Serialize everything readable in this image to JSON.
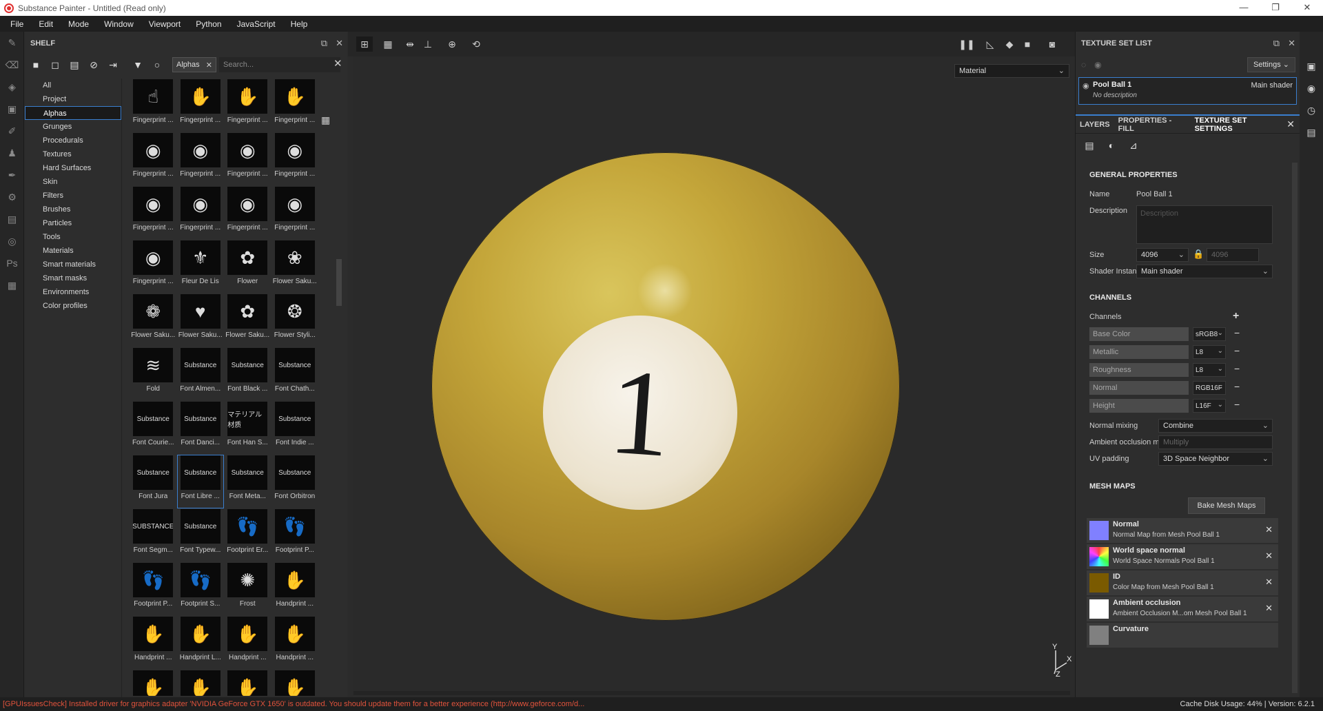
{
  "window": {
    "title": "Substance Painter - Untitled (Read only)",
    "controls": [
      "—",
      "❐",
      "✕"
    ]
  },
  "menu": [
    "File",
    "Edit",
    "Mode",
    "Window",
    "Viewport",
    "Python",
    "JavaScript",
    "Help"
  ],
  "shelf": {
    "title": "SHELF",
    "active_tag": "Alphas",
    "search_placeholder": "Search...",
    "categories": [
      "All",
      "Project",
      "Alphas",
      "Grunges",
      "Procedurals",
      "Textures",
      "Hard Surfaces",
      "Skin",
      "Filters",
      "Brushes",
      "Particles",
      "Tools",
      "Materials",
      "Smart materials",
      "Smart masks",
      "Environments",
      "Color profiles"
    ],
    "selected_category": "Alphas",
    "items": [
      [
        "Fingerprint ...",
        "Fingerprint ...",
        "Fingerprint ...",
        "Fingerprint ..."
      ],
      [
        "Fingerprint ...",
        "Fingerprint ...",
        "Fingerprint ...",
        "Fingerprint ..."
      ],
      [
        "Fingerprint ...",
        "Fingerprint ...",
        "Fingerprint ...",
        "Fingerprint ..."
      ],
      [
        "Fingerprint ...",
        "Fleur De Lis",
        "Flower",
        "Flower Saku..."
      ],
      [
        "Flower Saku...",
        "Flower Saku...",
        "Flower Saku...",
        "Flower Styli..."
      ],
      [
        "Fold",
        "Font Almen...",
        "Font Black ...",
        "Font Chath..."
      ],
      [
        "Font Courie...",
        "Font Danci...",
        "Font Han S...",
        "Font Indie ..."
      ],
      [
        "Font Jura",
        "Font Libre ...",
        "Font Meta...",
        "Font Orbitron"
      ],
      [
        "Font Segm...",
        "Font Typew...",
        "Footprint Er...",
        "Footprint P..."
      ],
      [
        "Footprint P...",
        "Footprint S...",
        "Frost",
        "Handprint ..."
      ],
      [
        "Handprint ...",
        "Handprint L...",
        "Handprint ...",
        "Handprint ..."
      ],
      [
        "",
        "",
        "",
        ""
      ]
    ],
    "thumb_glyphs": [
      [
        "☝",
        "✋",
        "✋",
        "✋"
      ],
      [
        "◉",
        "◉",
        "◉",
        "◉"
      ],
      [
        "◉",
        "◉",
        "◉",
        "◉"
      ],
      [
        "◉",
        "⚜",
        "✿",
        "❀"
      ],
      [
        "❁",
        "♥",
        "✿",
        "❂"
      ],
      [
        "≋",
        "Substance",
        "Substance",
        "Substance"
      ],
      [
        "Substance",
        "Substance",
        "マテリアル 材质",
        "Substance"
      ],
      [
        "Substance",
        "Substance",
        "Substance",
        "Substance"
      ],
      [
        "SUBSTANCE",
        "Substance",
        "👣",
        "👣"
      ],
      [
        "👣",
        "👣",
        "✺",
        "✋"
      ],
      [
        "✋",
        "✋",
        "✋",
        "✋"
      ],
      [
        "✋",
        "✋",
        "✋",
        "✋"
      ]
    ]
  },
  "viewport": {
    "channel_select": "Material",
    "ball_number": "1",
    "axis_y": "Y",
    "axis_x": "X",
    "axis_z": "Z"
  },
  "texture_set_list": {
    "title": "TEXTURE SET LIST",
    "settings_label": "Settings",
    "item_name": "Pool Ball 1",
    "item_shader": "Main shader",
    "item_description": "No description"
  },
  "tabs": [
    "LAYERS",
    "PROPERTIES - FILL",
    "TEXTURE SET SETTINGS"
  ],
  "active_tab": "TEXTURE SET SETTINGS",
  "general": {
    "title": "GENERAL PROPERTIES",
    "name_label": "Name",
    "name_value": "Pool Ball 1",
    "description_label": "Description",
    "description_placeholder": "Description",
    "size_label": "Size",
    "size_value": "4096",
    "size_linked_value": "4096",
    "shader_label": "Shader Instance",
    "shader_value": "Main shader"
  },
  "channels": {
    "title": "CHANNELS",
    "label": "Channels",
    "list": [
      {
        "name": "Base Color",
        "format": "sRGB8"
      },
      {
        "name": "Metallic",
        "format": "L8"
      },
      {
        "name": "Roughness",
        "format": "L8"
      },
      {
        "name": "Normal",
        "format": "RGB16F"
      },
      {
        "name": "Height",
        "format": "L16F"
      }
    ],
    "normal_mixing_label": "Normal mixing",
    "normal_mixing_value": "Combine",
    "ao_mixing_label": "Ambient occlusion mixing",
    "ao_mixing_value": "Multiply",
    "uv_padding_label": "UV padding",
    "uv_padding_value": "3D Space Neighbor"
  },
  "mesh_maps": {
    "title": "MESH MAPS",
    "bake_label": "Bake Mesh Maps",
    "items": [
      {
        "title": "Normal",
        "sub": "Normal Map from Mesh Pool Ball 1",
        "color": "#8080ff"
      },
      {
        "title": "World space normal",
        "sub": "World Space Normals Pool Ball 1",
        "color": "#c060c0"
      },
      {
        "title": "ID",
        "sub": "Color Map from Mesh Pool Ball 1",
        "color": "#7a5a00"
      },
      {
        "title": "Ambient occlusion",
        "sub": "Ambient Occlusion M...om Mesh Pool Ball 1",
        "color": "#ffffff"
      },
      {
        "title": "Curvature",
        "sub": "",
        "color": "#808080"
      }
    ]
  },
  "status": {
    "error": "[GPUIssuesCheck] Installed driver for graphics adapter 'NVIDIA GeForce GTX 1650' is outdated. You should update them for a better experience (http://www.geforce.com/d...",
    "right": "Cache Disk Usage:   44% | Version: 6.2.1"
  }
}
